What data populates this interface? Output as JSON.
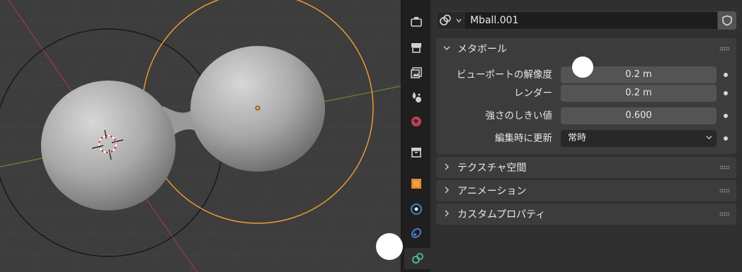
{
  "datablock": {
    "name": "Mball.001",
    "type_icon": "metaball-icon",
    "fake_user_icon": "shield-icon"
  },
  "tabs": [
    {
      "name": "tool-tab",
      "icon": "tool-icon"
    },
    {
      "name": "render-tab",
      "icon": "render-icon"
    },
    {
      "name": "output-tab",
      "icon": "output-icon"
    },
    {
      "name": "view-layer-tab",
      "icon": "view-layer-icon"
    },
    {
      "name": "scene-tab",
      "icon": "scene-icon"
    },
    {
      "name": "world-tab",
      "icon": "world-icon"
    },
    {
      "name": "collection-tab",
      "icon": "collection-icon"
    },
    {
      "name": "object-tab",
      "icon": "object-icon"
    },
    {
      "name": "physics-tab",
      "icon": "physics-icon"
    },
    {
      "name": "constraints-tab",
      "icon": "constraints-icon"
    },
    {
      "name": "data-tab",
      "icon": "metaball-data-icon",
      "active": true
    }
  ],
  "panels": {
    "metaball": {
      "title": "メタボール",
      "expanded": true,
      "rows": [
        {
          "label": "ビューポートの解像度",
          "value": "0.2 m"
        },
        {
          "label": "レンダー",
          "value": "0.2 m"
        },
        {
          "label": "強さのしきい値",
          "value": "0.600"
        },
        {
          "label": "編集時に更新",
          "value": "常時",
          "dropdown": true
        }
      ]
    },
    "texture_space": {
      "title": "テクスチャ空間",
      "expanded": false
    },
    "animation": {
      "title": "アニメーション",
      "expanded": false
    },
    "custom_props": {
      "title": "カスタムプロパティ",
      "expanded": false
    }
  },
  "colors": {
    "viewport_bg": "#3d3d3d",
    "panel_bg": "#303030",
    "selection_orange": "#f0a030",
    "x_axis": "#9b3b46",
    "y_axis": "#6a8a2a"
  }
}
